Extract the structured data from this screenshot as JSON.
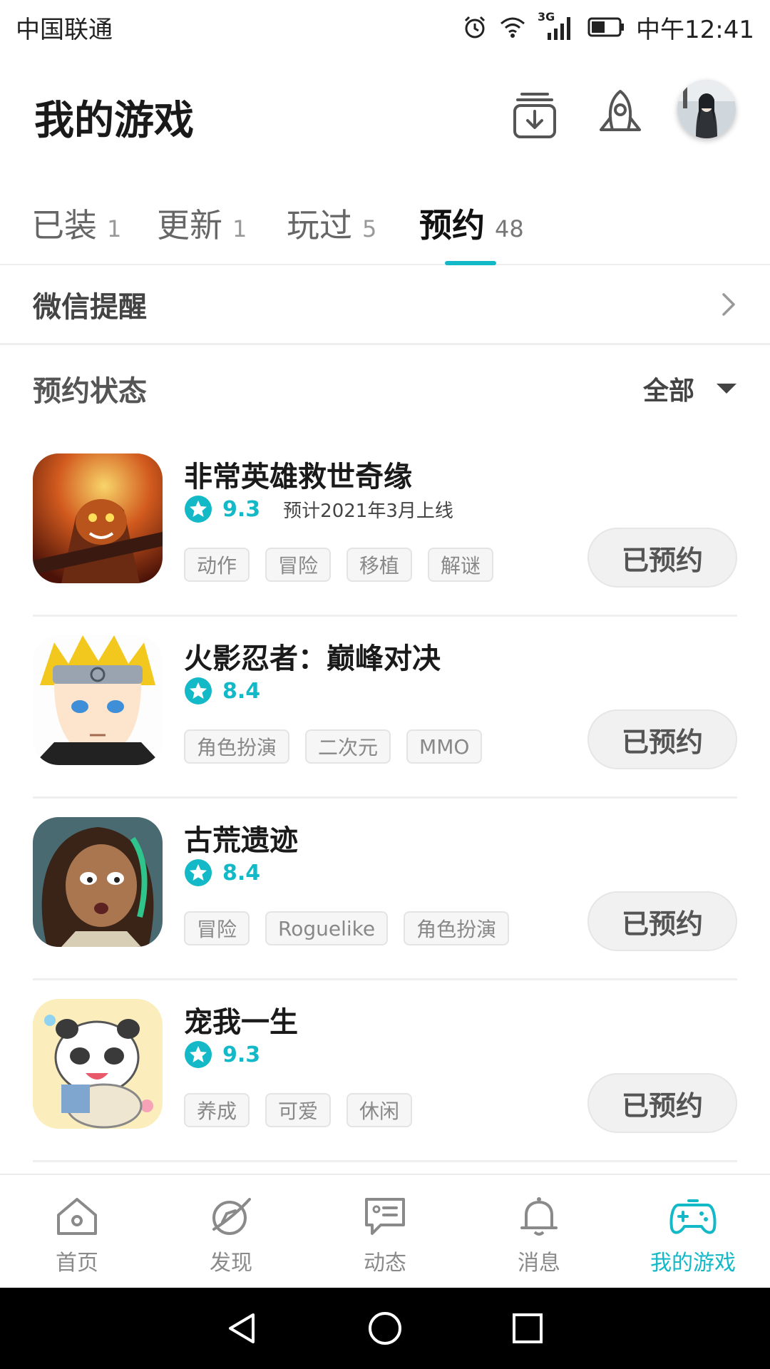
{
  "status_bar": {
    "carrier": "中国联通",
    "network": "3G",
    "time": "中午12:41"
  },
  "header": {
    "title": "我的游戏"
  },
  "tabs": [
    {
      "label": "已装",
      "count": "1"
    },
    {
      "label": "更新",
      "count": "1"
    },
    {
      "label": "玩过",
      "count": "5"
    },
    {
      "label": "预约",
      "count": "48"
    }
  ],
  "wechat": {
    "label": "微信提醒"
  },
  "filter": {
    "label": "预约状态",
    "value": "全部"
  },
  "games": [
    {
      "name": "非常英雄救世奇缘",
      "rating": "9.3",
      "release": "预计2021年3月上线",
      "tags": [
        "动作",
        "冒险",
        "移植",
        "解谜"
      ],
      "button": "已预约"
    },
    {
      "name": "火影忍者：巅峰对决",
      "rating": "8.4",
      "tags": [
        "角色扮演",
        "二次元",
        "MMO"
      ],
      "button": "已预约"
    },
    {
      "name": "古荒遗迹",
      "rating": "8.4",
      "tags": [
        "冒险",
        "Roguelike",
        "角色扮演"
      ],
      "button": "已预约"
    },
    {
      "name": "宠我一生",
      "rating": "9.3",
      "tags": [
        "养成",
        "可爱",
        "休闲"
      ],
      "button": "已预约"
    }
  ],
  "bottom_nav": [
    {
      "label": "首页",
      "icon": "home-icon"
    },
    {
      "label": "发现",
      "icon": "discover-icon"
    },
    {
      "label": "动态",
      "icon": "feed-icon"
    },
    {
      "label": "消息",
      "icon": "bell-icon"
    },
    {
      "label": "我的游戏",
      "icon": "gamepad-icon"
    }
  ],
  "colors": {
    "accent": "#14b9c8"
  }
}
